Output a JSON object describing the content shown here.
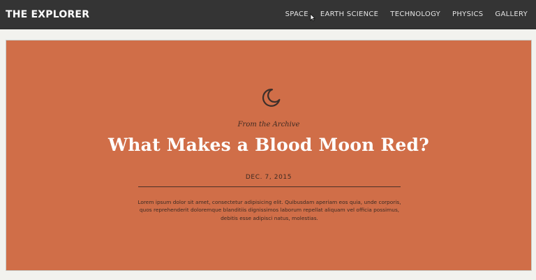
{
  "nav": {
    "brand": "THE EXPLORER",
    "links": [
      {
        "label": "SPACE"
      },
      {
        "label": "EARTH SCIENCE"
      },
      {
        "label": "TECHNOLOGY"
      },
      {
        "label": "PHYSICS"
      },
      {
        "label": "GALLERY"
      }
    ],
    "cursor_icon": "pointer-cursor"
  },
  "hero": {
    "background_color": "#d06e48",
    "icon": "moon-icon",
    "eyebrow": "From the Archive",
    "title": "What Makes a Blood Moon Red?",
    "date": "DEC. 7, 2015",
    "body": "Lorem ipsum dolor sit amet, consectetur adipisicing elit. Quibusdam aperiam eos quia, unde corporis, quos reprehenderit doloremque blanditiis dignissimos laborum repellat aliquam vel officia possimus, debitis esse adipisci natus, molestias."
  }
}
